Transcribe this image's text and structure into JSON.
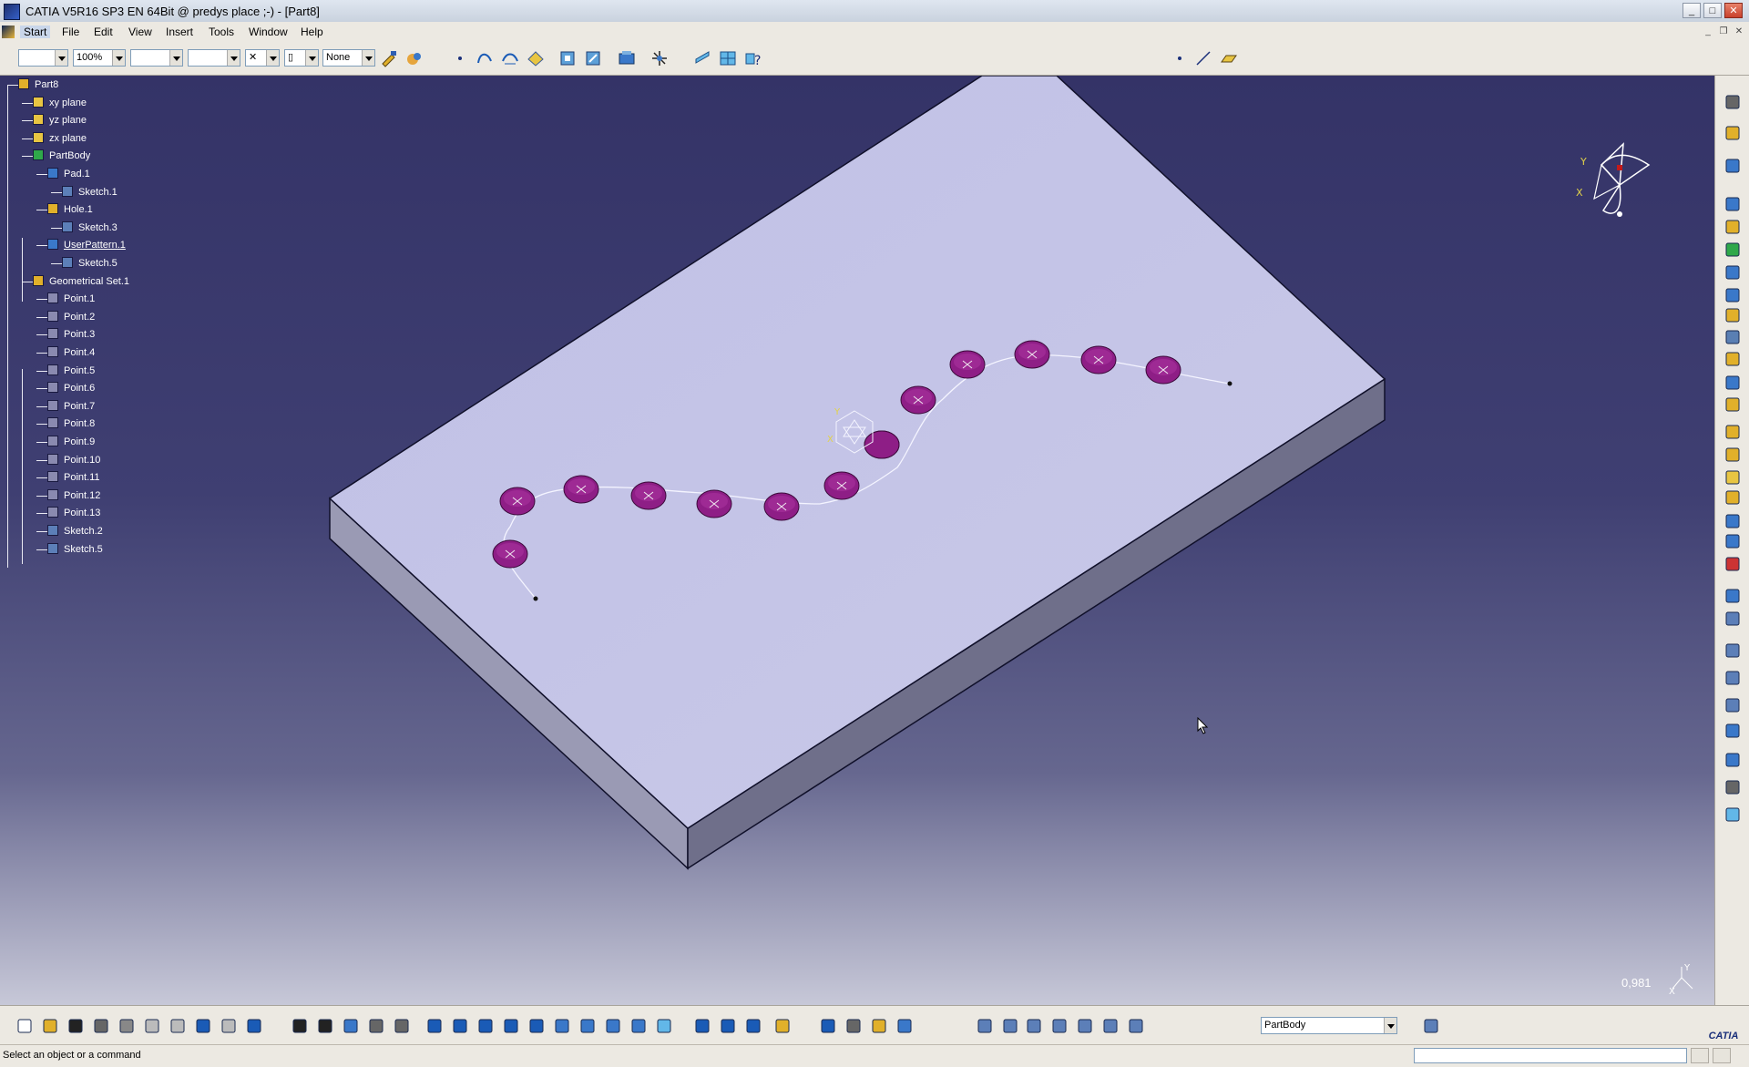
{
  "window": {
    "title": "CATIA V5R16 SP3 EN 64Bit @ predys place ;-) - [Part8]",
    "minimize": "_",
    "maximize": "□",
    "close": "✕"
  },
  "menu": {
    "items": [
      "Start",
      "File",
      "Edit",
      "View",
      "Insert",
      "Tools",
      "Window",
      "Help"
    ]
  },
  "top_toolbar": {
    "zoom": "100%",
    "layer": "None",
    "icons": [
      "snap-point-icon",
      "curve-icon",
      "spline-icon",
      "surface-icon",
      "view-icon",
      "view2-icon",
      "render-icon",
      "compass-icon",
      "sketch-icon",
      "grid-icon",
      "help-icon",
      "point-icon",
      "line-icon",
      "plane-icon"
    ]
  },
  "tree": {
    "nodes": [
      {
        "label": "Part8",
        "icon": "part-icon"
      },
      {
        "label": "xy plane",
        "icon": "plane-icon"
      },
      {
        "label": "yz plane",
        "icon": "plane-icon"
      },
      {
        "label": "zx plane",
        "icon": "plane-icon"
      },
      {
        "label": "PartBody",
        "icon": "body-icon"
      },
      {
        "label": "Pad.1",
        "icon": "pad-icon"
      },
      {
        "label": "Sketch.1",
        "icon": "sketch-icon"
      },
      {
        "label": "Hole.1",
        "icon": "hole-icon"
      },
      {
        "label": "Sketch.3",
        "icon": "sketch-icon"
      },
      {
        "label": "UserPattern.1",
        "icon": "pattern-icon"
      },
      {
        "label": "Sketch.5",
        "icon": "sketch-icon"
      },
      {
        "label": "Geometrical Set.1",
        "icon": "geoset-icon"
      },
      {
        "label": "Point.1",
        "icon": "point-icon"
      },
      {
        "label": "Point.2",
        "icon": "point-icon"
      },
      {
        "label": "Point.3",
        "icon": "point-icon"
      },
      {
        "label": "Point.4",
        "icon": "point-icon"
      },
      {
        "label": "Point.5",
        "icon": "point-icon"
      },
      {
        "label": "Point.6",
        "icon": "point-icon"
      },
      {
        "label": "Point.7",
        "icon": "point-icon"
      },
      {
        "label": "Point.8",
        "icon": "point-icon"
      },
      {
        "label": "Point.9",
        "icon": "point-icon"
      },
      {
        "label": "Point.10",
        "icon": "point-icon"
      },
      {
        "label": "Point.11",
        "icon": "point-icon"
      },
      {
        "label": "Point.12",
        "icon": "point-icon"
      },
      {
        "label": "Point.13",
        "icon": "point-icon"
      },
      {
        "label": "Sketch.2",
        "icon": "sketch-icon"
      },
      {
        "label": "Sketch.5",
        "icon": "sketch-icon"
      }
    ]
  },
  "viewport": {
    "background_top": "#343367",
    "background_bottom": "#c7c8d8",
    "part_top_color": "#c3c3e6",
    "part_side_left": "#9a9ab4",
    "part_side_right": "#6f6f8a",
    "hole_color": "#8e1e86",
    "hole_count": 14,
    "compass_axes": [
      "Y",
      "X"
    ],
    "zoom_readout": "0,981",
    "mini_axes": [
      "Y",
      "X"
    ]
  },
  "bottom_toolbar": {
    "current_body": "PartBody",
    "icons": [
      "new-icon",
      "open-icon",
      "save-icon",
      "print-icon",
      "cut-icon",
      "copy-icon",
      "paste-icon",
      "undo-icon",
      "redo-icon",
      "whats-this-icon",
      "formula-icon",
      "comment-icon",
      "table-icon",
      "catalog-icon",
      "analysis-icon",
      "fit-all-icon",
      "pan-icon",
      "rotate-icon",
      "zoom-in-icon",
      "zoom-out-icon",
      "normal-view-icon",
      "multi-view-icon",
      "iso-view-icon",
      "shading-icon",
      "hide-show-icon",
      "swap-icon",
      "measure-icon",
      "inertia-icon",
      "axis-icon",
      "constraint-icon",
      "dimension-icon",
      "work-object-icon",
      "apply-material-icon"
    ]
  },
  "status": {
    "message": "Select an object or a command"
  },
  "brand": "CATIA"
}
